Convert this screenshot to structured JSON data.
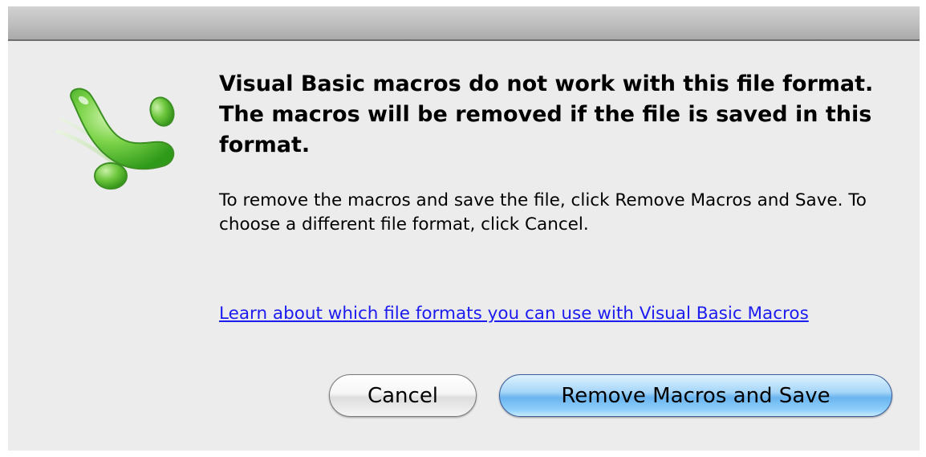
{
  "dialog": {
    "headline": "Visual Basic macros do not work with this file format. The macros will be removed if the file is saved in this format.",
    "body": "To remove the macros and save the file, click Remove Macros and Save. To choose a different file format, click Cancel.",
    "help_link": "Learn about which file formats you can use with Visual Basic Macros",
    "app_icon": "excel-icon",
    "buttons": {
      "cancel": "Cancel",
      "primary": "Remove Macros and Save"
    }
  },
  "colors": {
    "background": "#ececec",
    "link": "#1c1cf0",
    "icon_green": "#4cb82a",
    "primary_button": "#8fd0fb"
  }
}
